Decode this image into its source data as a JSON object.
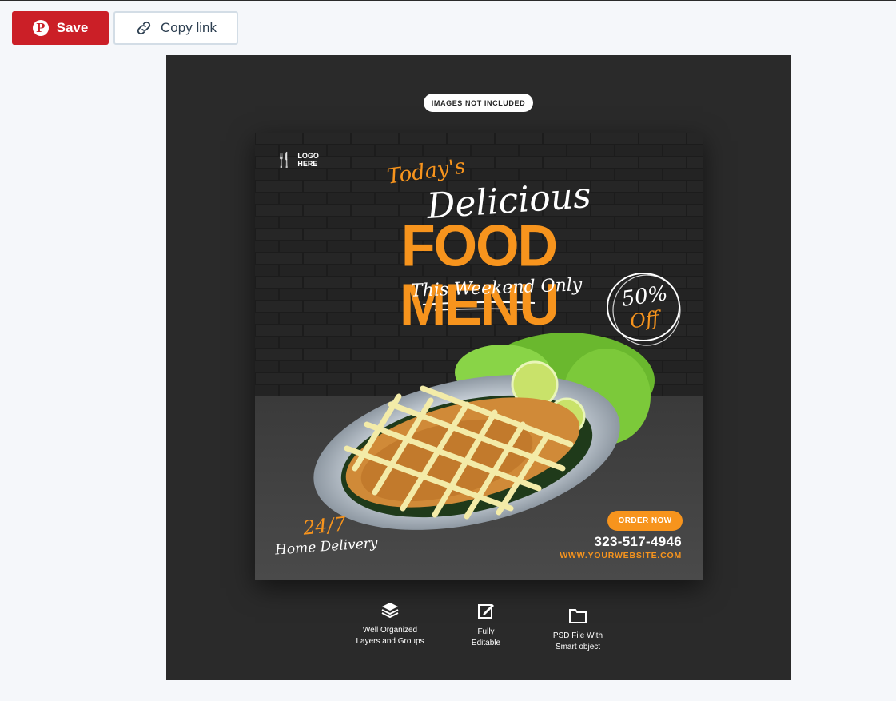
{
  "toolbar": {
    "save_label": "Save",
    "copy_link_label": "Copy link"
  },
  "preview": {
    "badge": "IMAGES NOT INCLUDED",
    "post": {
      "logo_line1": "LOGO",
      "logo_line2": "HERE",
      "heading_today": "Today's",
      "heading_delicious": "Delicious",
      "heading_food_menu": "FOOD MENU",
      "subheading": "This Weekend Only",
      "discount_percent": "50%",
      "discount_off": "Off",
      "delivery_hours": "24/7",
      "delivery_text": "Home Delivery",
      "order_button": "ORDER NOW",
      "phone": "323-517-4946",
      "website": "WWW.YOURWEBSITE.COM"
    },
    "features": [
      {
        "icon": "layers-icon",
        "line1": "Well Organized",
        "line2": "Layers and Groups"
      },
      {
        "icon": "edit-icon",
        "line1": "Fully",
        "line2": "Editable"
      },
      {
        "icon": "folder-icon",
        "line1": "PSD File With",
        "line2": "Smart object"
      }
    ]
  },
  "colors": {
    "save_red": "#cb1f27",
    "accent_orange": "#f7941d",
    "frame_dark": "#2a2a2a",
    "page_bg": "#f5f7fa"
  }
}
